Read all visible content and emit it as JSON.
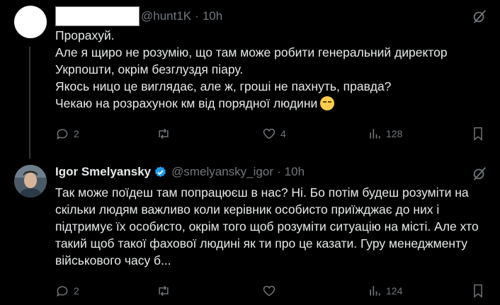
{
  "tweet1": {
    "handle": "@hunt1K",
    "time": "10h",
    "lines": [
      "Прорахуй.",
      "Але я щиро не розумію, що там може робити генеральний директор",
      "Укрпошти, окрім безглуздя піару.",
      "Якось ницо це виглядає, але ж, гроші не пахнуть, правда?",
      "Чекаю на розрахунок км від порядної людини"
    ],
    "emoji": "relieved-face",
    "replies": "2",
    "retweets": "",
    "likes": "4",
    "views": "128"
  },
  "tweet2": {
    "name": "Igor Smelyansky",
    "handle": "@smelyansky_igor",
    "time": "10h",
    "lines": [
      "Так може поїдеш там попрацюєш в нас? Ні. Бо потім будеш розуміти на",
      "скільки людям важливо коли керівник особисто приїжджає до них і",
      "підтримує їх особисто, окрім того щоб розуміти ситуацію на місті. Але хто",
      "такий щоб такої фахової людині як ти про це казати. Гуру менеджменту",
      "військового часу б..."
    ],
    "replies": "2",
    "retweets": "",
    "likes": "",
    "views": "124"
  },
  "separator": "·",
  "colors": {
    "background": "#000000",
    "text": "#e7e9ea",
    "muted": "#71767b",
    "verified": "#1d9bf0"
  },
  "icons": [
    "grok-icon",
    "reply-icon",
    "retweet-icon",
    "like-icon",
    "views-icon",
    "bookmark-icon",
    "verified-badge-icon"
  ]
}
